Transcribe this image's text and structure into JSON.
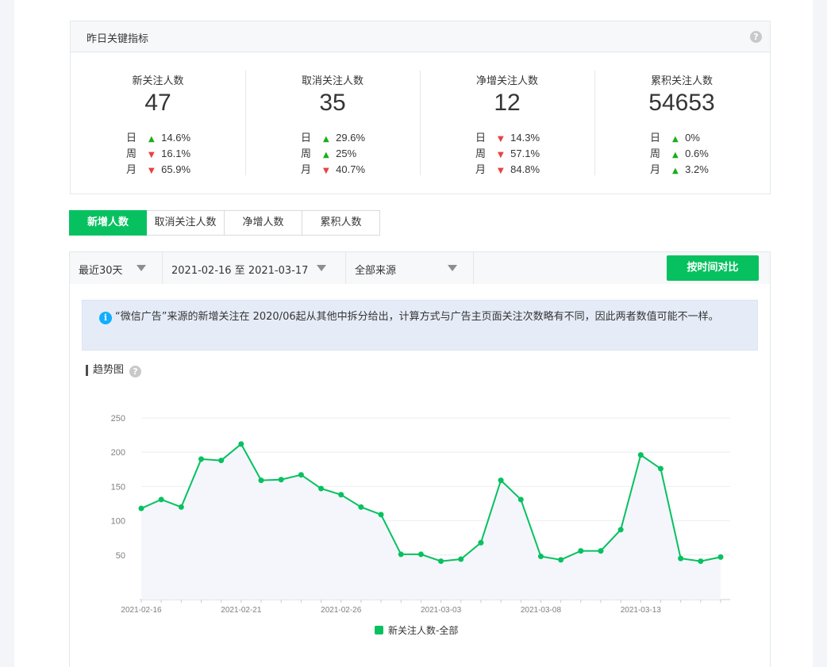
{
  "metrics": {
    "title": "昨日关键指标",
    "help_icon": "question-circle-icon",
    "items": [
      {
        "label": "新关注人数",
        "value": "47",
        "rows": [
          {
            "period": "日",
            "dir": "up",
            "pct": "14.6%"
          },
          {
            "period": "周",
            "dir": "down",
            "pct": "16.1%"
          },
          {
            "period": "月",
            "dir": "down",
            "pct": "65.9%"
          }
        ]
      },
      {
        "label": "取消关注人数",
        "value": "35",
        "rows": [
          {
            "period": "日",
            "dir": "up",
            "pct": "29.6%"
          },
          {
            "period": "周",
            "dir": "up",
            "pct": "25%"
          },
          {
            "period": "月",
            "dir": "down",
            "pct": "40.7%"
          }
        ]
      },
      {
        "label": "净增关注人数",
        "value": "12",
        "rows": [
          {
            "period": "日",
            "dir": "down",
            "pct": "14.3%"
          },
          {
            "period": "周",
            "dir": "down",
            "pct": "57.1%"
          },
          {
            "period": "月",
            "dir": "down",
            "pct": "84.8%"
          }
        ]
      },
      {
        "label": "累积关注人数",
        "value": "54653",
        "rows": [
          {
            "period": "日",
            "dir": "up",
            "pct": "0%"
          },
          {
            "period": "周",
            "dir": "up",
            "pct": "0.6%"
          },
          {
            "period": "月",
            "dir": "up",
            "pct": "3.2%"
          }
        ]
      }
    ]
  },
  "tabs": [
    {
      "label": "新增人数",
      "active": true
    },
    {
      "label": "取消关注人数",
      "active": false
    },
    {
      "label": "净增人数",
      "active": false
    },
    {
      "label": "累积人数",
      "active": false
    }
  ],
  "filters": {
    "range": "最近30天",
    "dates": "2021-02-16 至 2021-03-17",
    "source": "全部来源",
    "compare_button": "按时间对比"
  },
  "notice": {
    "icon": "info-icon",
    "text": "“微信广告”来源的新增关注在 2020/06起从其他中拆分给出，计算方式与广告主页面关注次数略有不同，因此两者数值可能不一样。"
  },
  "trend": {
    "title": "趋势图"
  },
  "colors": {
    "accent": "#07c160",
    "up": "#1aad19",
    "down": "#e64340"
  },
  "chart_data": {
    "type": "line",
    "x": [
      "2021-02-16",
      "2021-02-17",
      "2021-02-18",
      "2021-02-19",
      "2021-02-20",
      "2021-02-21",
      "2021-02-22",
      "2021-02-23",
      "2021-02-24",
      "2021-02-25",
      "2021-02-26",
      "2021-02-27",
      "2021-02-28",
      "2021-03-01",
      "2021-03-02",
      "2021-03-03",
      "2021-03-04",
      "2021-03-05",
      "2021-03-06",
      "2021-03-07",
      "2021-03-08",
      "2021-03-09",
      "2021-03-10",
      "2021-03-11",
      "2021-03-12",
      "2021-03-13",
      "2021-03-14",
      "2021-03-15",
      "2021-03-16",
      "2021-03-17"
    ],
    "x_tick_labels": [
      "2021-02-16",
      "2021-02-21",
      "2021-02-26",
      "2021-03-03",
      "2021-03-08",
      "2021-03-13"
    ],
    "series": [
      {
        "name": "新关注人数-全部",
        "values": [
          118,
          131,
          120,
          190,
          188,
          212,
          159,
          160,
          167,
          147,
          138,
          120,
          109,
          51,
          51,
          41,
          44,
          68,
          159,
          131,
          48,
          43,
          56,
          56,
          87,
          196,
          176,
          45,
          41,
          47
        ]
      }
    ],
    "y_ticks": [
      50,
      100,
      150,
      200,
      250
    ],
    "ylim": [
      0,
      250
    ],
    "grid": true,
    "legend": "bottom-center"
  }
}
